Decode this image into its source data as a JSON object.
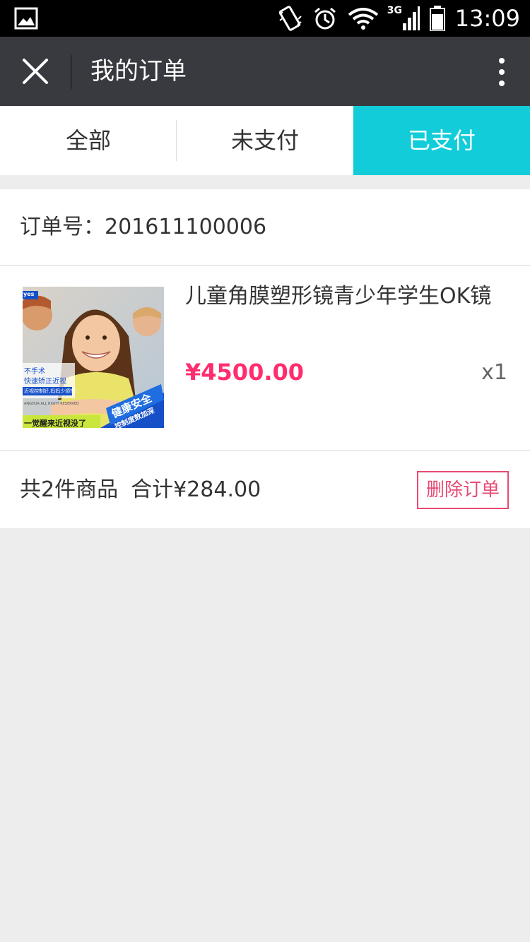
{
  "status_bar": {
    "time": "13:09",
    "network": "3G",
    "icons": [
      "gallery-icon",
      "vibrate-icon",
      "alarm-icon",
      "wifi-icon",
      "signal-icon",
      "battery-icon"
    ]
  },
  "nav": {
    "title": "我的订单",
    "close_icon": "close-icon",
    "more_icon": "more-vertical-icon"
  },
  "tabs": [
    {
      "label": "全部",
      "active": false
    },
    {
      "label": "未支付",
      "active": false
    },
    {
      "label": "已支付",
      "active": true
    }
  ],
  "order": {
    "order_no": "订单号：201611100006",
    "product": {
      "name": "儿童角膜塑形镜青少年学生OK镜",
      "price": "¥4500.00",
      "qty": "x1",
      "image_text": {
        "badge": "yes",
        "line1": "不手术",
        "line2": "快速矫正近视",
        "line3": "近视控制好,妈妈少烦恼!",
        "line4": "ANGHUA ALL RIGHT RESERVED",
        "banner_main": "健康安全",
        "banner_sub": "控制度数加深",
        "bottom": "一觉醒来近视没了"
      }
    },
    "summary_count": "共2件商品",
    "summary_total": "合计¥284.00",
    "delete_label": "删除订单"
  },
  "colors": {
    "accent": "#12cdd9",
    "price": "#ff2d6e",
    "delete": "#e84a73",
    "navbar": "#393a3f",
    "background": "#ededed"
  }
}
